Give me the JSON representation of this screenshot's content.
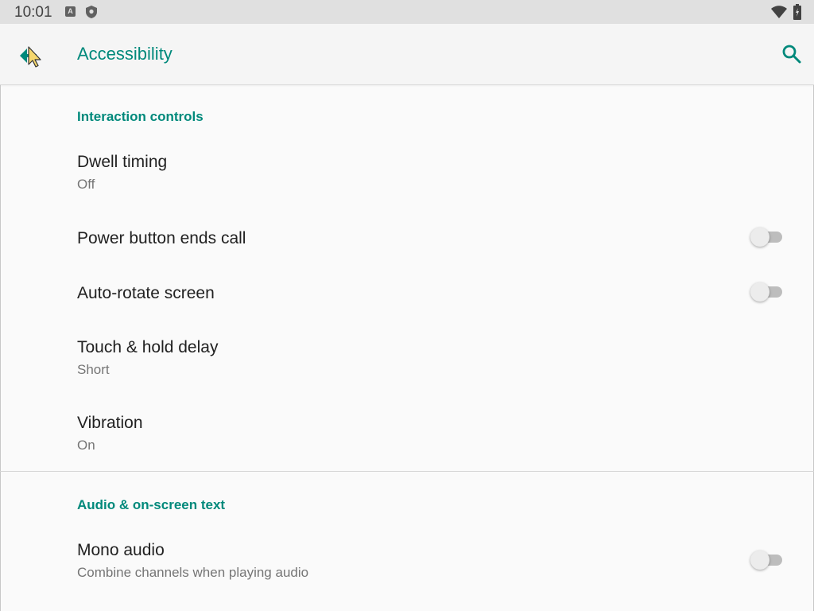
{
  "status_bar": {
    "time": "10:01",
    "icons": [
      "a-notification-icon",
      "shield-icon",
      "wifi-icon",
      "battery-icon"
    ]
  },
  "toolbar": {
    "title": "Accessibility",
    "back_icon": "back-arrow-icon",
    "search_icon": "search-icon"
  },
  "sections": [
    {
      "header": "Interaction controls",
      "items": [
        {
          "title": "Dwell timing",
          "summary": "Off"
        },
        {
          "title": "Power button ends call",
          "switch_on": false
        },
        {
          "title": "Auto-rotate screen",
          "switch_on": false
        },
        {
          "title": "Touch & hold delay",
          "summary": "Short"
        },
        {
          "title": "Vibration",
          "summary": "On"
        }
      ]
    },
    {
      "header": "Audio & on-screen text",
      "items": [
        {
          "title": "Mono audio",
          "summary": "Combine channels when playing audio",
          "switch_on": false
        }
      ]
    }
  ],
  "colors": {
    "accent": "#00897b",
    "status_bar": "#e0e0e0",
    "toolbar": "#f5f5f5",
    "background": "#fafafa"
  }
}
